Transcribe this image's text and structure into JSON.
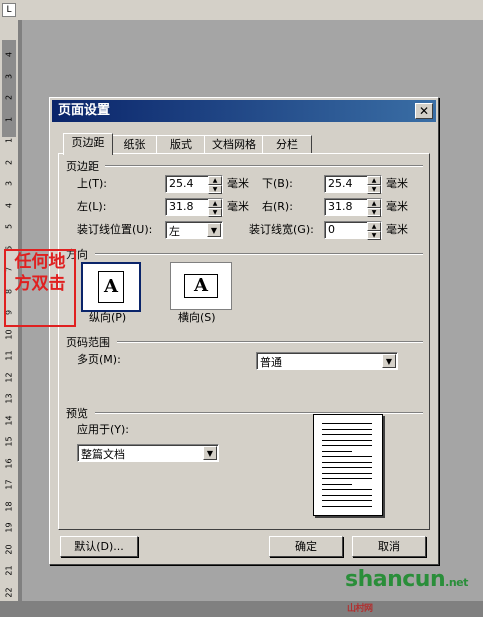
{
  "ruler": {
    "corner_label": "L",
    "numbers": [
      "4",
      "3",
      "2",
      "1",
      "1",
      "2",
      "3",
      "4",
      "5",
      "6",
      "7",
      "8",
      "9",
      "10",
      "11",
      "12",
      "13",
      "14",
      "15",
      "16",
      "17",
      "18",
      "19",
      "20",
      "21",
      "22"
    ]
  },
  "dialog": {
    "title": "页面设置",
    "close_glyph": "✕",
    "tabs": [
      "页边距",
      "纸张",
      "版式",
      "文档网格",
      "分栏"
    ],
    "active_tab": 0,
    "margins": {
      "section": "页边距",
      "top_label": "上(T):",
      "top_value": "25.4",
      "top_unit": "毫米",
      "bottom_label": "下(B):",
      "bottom_value": "25.4",
      "bottom_unit": "毫米",
      "left_label": "左(L):",
      "left_value": "31.8",
      "left_unit": "毫米",
      "right_label": "右(R):",
      "right_value": "31.8",
      "right_unit": "毫米",
      "gutter_pos_label": "装订线位置(U):",
      "gutter_pos_value": "左",
      "gutter_label": "装订线宽(G):",
      "gutter_value": "0",
      "gutter_unit": "毫米"
    },
    "orientation": {
      "section": "方向",
      "portrait_label": "纵向(P)",
      "landscape_label": "横向(S)",
      "glyph": "A"
    },
    "pages": {
      "section": "页码范围",
      "multiple_label": "多页(M):",
      "multiple_value": "普通"
    },
    "preview": {
      "section": "预览",
      "apply_label": "应用于(Y):",
      "apply_value": "整篇文档"
    },
    "buttons": {
      "default": "默认(D)...",
      "ok": "确定",
      "cancel": "取消"
    }
  },
  "callout": {
    "line1": "任何地",
    "line2": "方双击",
    "color": "#e02020"
  },
  "watermark": {
    "text": "shancun",
    "suffix": ".net",
    "sub": "山村网"
  }
}
